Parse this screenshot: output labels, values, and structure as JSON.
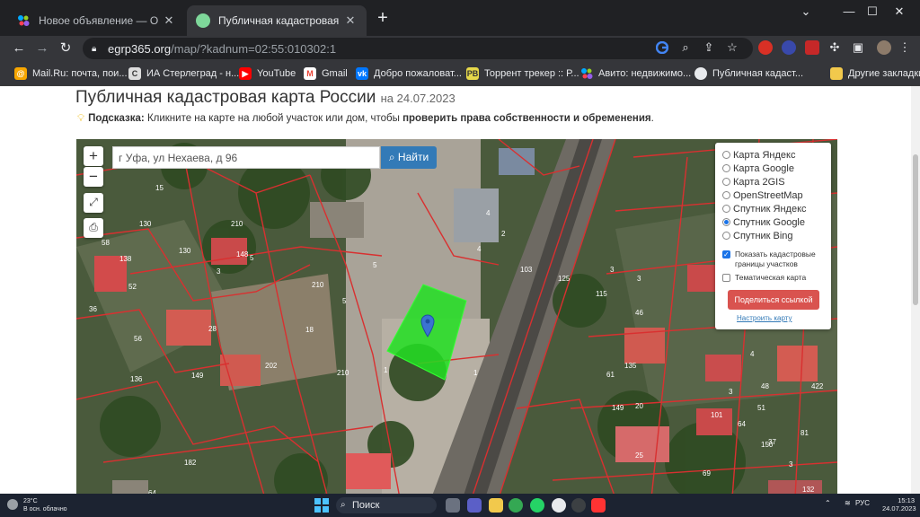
{
  "browser": {
    "tabs": [
      {
        "title": "Новое объявление — Объявлен",
        "active": false
      },
      {
        "title": "Публичная кадастровая карта",
        "active": true
      }
    ],
    "url_host": "egrp365.org",
    "url_path": "/map/?kadnum=02:55:010302:1",
    "bookmarks": [
      "Mail.Ru: почта, пои...",
      "ИА Стерлеград - н...",
      "YouTube",
      "Gmail",
      "Добро пожаловат...",
      "Торрент трекер :: Р...",
      "Авито: недвижимо...",
      "Публичная кадаст...",
      "Другие закладки"
    ]
  },
  "page": {
    "title": "Публичная кадастровая карта России",
    "date": "на 24.07.2023",
    "hint_label": "Подсказка:",
    "hint_text": "Кликните на карте на любой участок или дом, чтобы",
    "hint_bold": "проверить права собственности и обременения",
    "hint_end": "."
  },
  "map": {
    "search_value": "г Уфа, ул Нехаева, д 96",
    "find_label": "Найти",
    "zoom_in": "+",
    "zoom_out": "−",
    "layers": [
      {
        "label": "Карта Яндекс",
        "selected": false
      },
      {
        "label": "Карта Google",
        "selected": false
      },
      {
        "label": "Карта 2GIS",
        "selected": false
      },
      {
        "label": "OpenStreetMap",
        "selected": false
      },
      {
        "label": "Спутник Яндекс",
        "selected": false
      },
      {
        "label": "Спутник Google",
        "selected": true
      },
      {
        "label": "Спутник Bing",
        "selected": false
      }
    ],
    "show_borders_label": "Показать кадастровые границы участков",
    "show_borders_checked": true,
    "thematic_label": "Тематическая карта",
    "thematic_checked": false,
    "share_label": "Поделиться ссылкой",
    "settings_link": "Настроить карту",
    "parcel_numbers": [
      "15",
      "58",
      "130",
      "130",
      "210",
      "5",
      "148",
      "3",
      "138",
      "52",
      "36",
      "56",
      "210",
      "28",
      "18",
      "202",
      "149",
      "136",
      "5",
      "210",
      "1",
      "182",
      "64",
      "4",
      "2",
      "4",
      "3",
      "125",
      "103",
      "46",
      "3",
      "115",
      "61",
      "135",
      "149",
      "20",
      "48",
      "4",
      "3",
      "64",
      "422",
      "101",
      "51",
      "81",
      "37",
      "150",
      "3",
      "132",
      "69",
      "25",
      "1",
      "5"
    ]
  },
  "taskbar": {
    "temp": "23°C",
    "weather": "В осн. облачно",
    "search_label": "Поиск",
    "lang": "РУС",
    "time": "15:13",
    "date": "24.07.2023"
  }
}
